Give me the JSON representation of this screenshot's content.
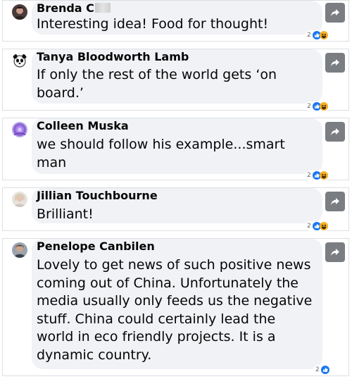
{
  "comments": [
    {
      "author": "Brenda C",
      "author_blurred": true,
      "text": "Interesting idea! Food for thought!",
      "reaction_count": "2",
      "reactions": [
        "like-icon",
        "haha-icon"
      ],
      "avatar": "person-photo"
    },
    {
      "author": "Tanya Bloodworth Lamb",
      "text": "If only the rest of the world gets ‘on\nboard.’",
      "reaction_count": "2",
      "reactions": [
        "like-icon",
        "haha-icon"
      ],
      "avatar": "panda-avatar"
    },
    {
      "author": "Colleen Muska",
      "text": "we should follow his example...smart\nman",
      "reaction_count": "2",
      "reactions": [
        "like-icon",
        "haha-icon"
      ],
      "avatar": "purple-flower-avatar"
    },
    {
      "author": "Jillian Touchbourne",
      "text": "Brilliant!",
      "reaction_count": "2",
      "reactions": [
        "like-icon",
        "haha-icon"
      ],
      "avatar": "person-photo"
    },
    {
      "author": "Penelope Canbilen",
      "text": "Lovely to get news of such positive news\ncoming out of China. Unfortunately the\nmedia usually only feeds us the negative\nstuff. China could certainly lead the\nworld in eco friendly projects. It is a\ndynamic country.",
      "reaction_count": "2",
      "reactions": [
        "like-icon"
      ],
      "avatar": "person-photo"
    }
  ],
  "colors": {
    "bubble": "#f0f2f5",
    "share_button": "#7a7d82",
    "like_blue": "#1877f2",
    "haha_yellow": "#f7b125"
  }
}
